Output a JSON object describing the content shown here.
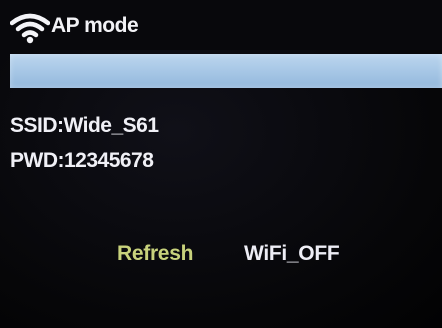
{
  "header": {
    "title": "AP mode",
    "icon": "wifi-icon"
  },
  "info": {
    "ssid": "SSID:Wide_S61",
    "pwd": "PWD:12345678"
  },
  "actions": {
    "refresh_label": "Refresh",
    "wifi_off_label": "WiFi_OFF"
  },
  "colors": {
    "background": "#08080c",
    "highlight_bar": "#a7c7e6",
    "selected_button": "#c8d27c",
    "text": "#f0f0f6"
  }
}
